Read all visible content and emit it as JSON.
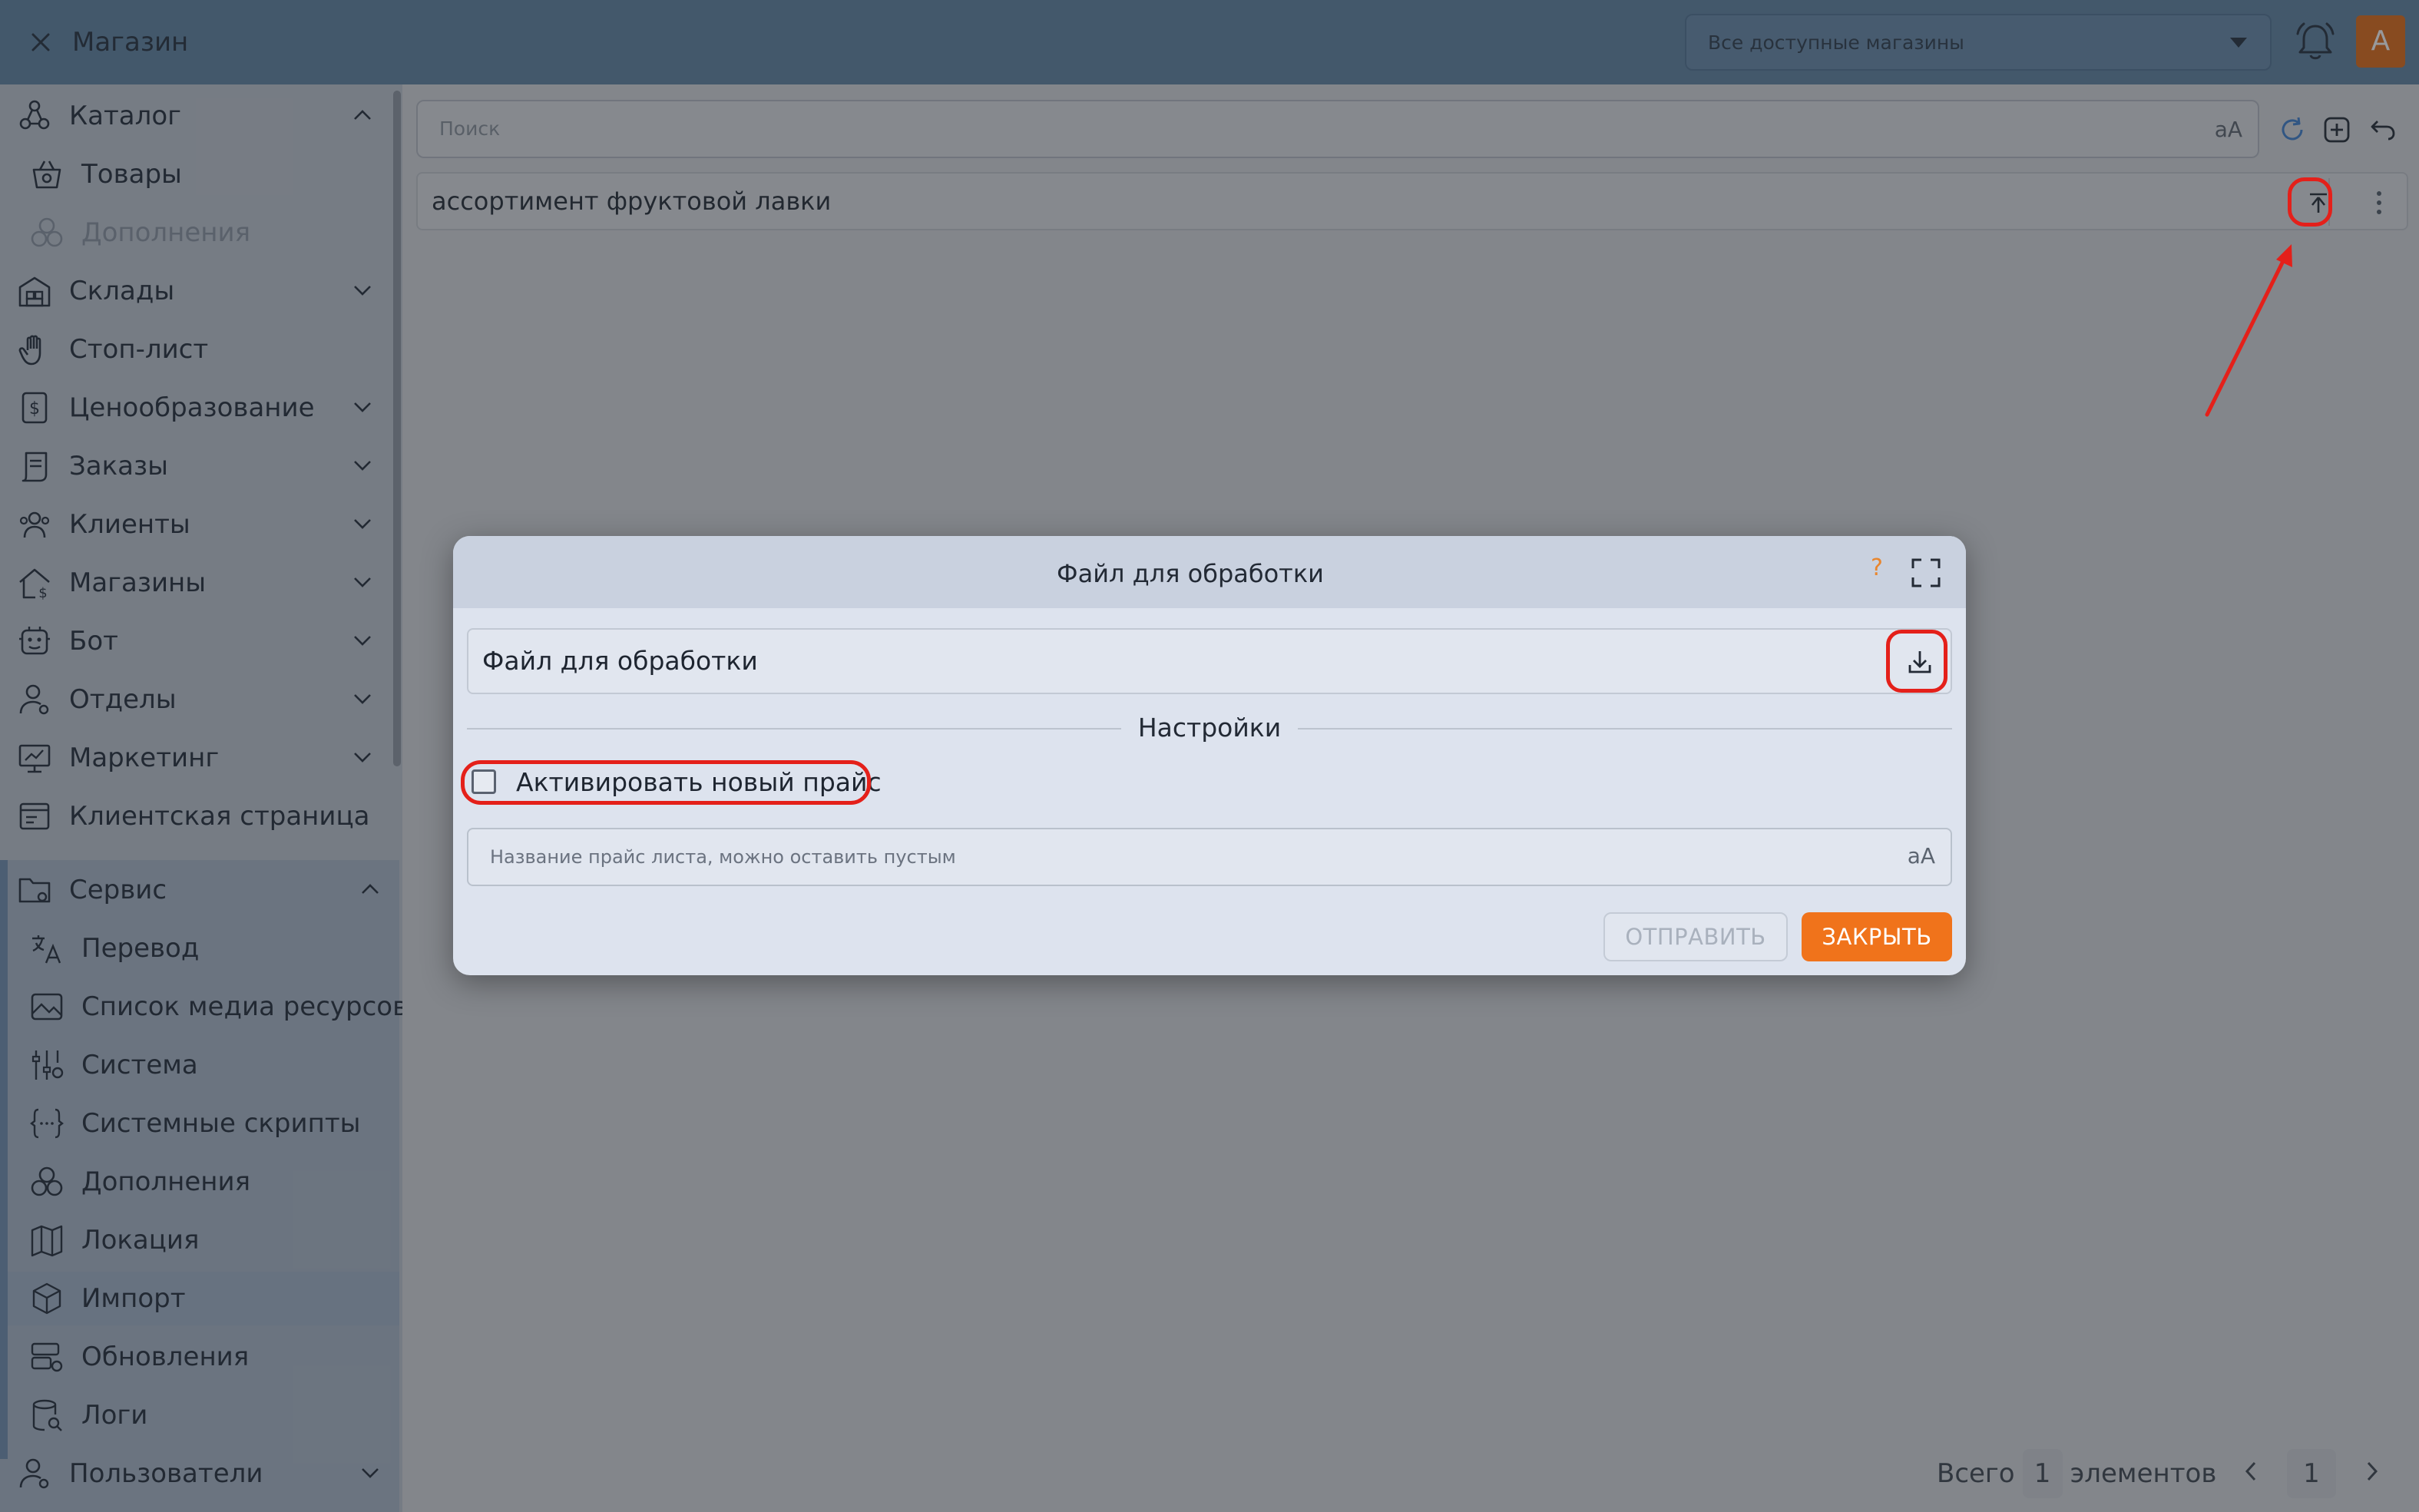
{
  "app": {
    "title": "Магазин"
  },
  "header": {
    "store_select_value": "Все доступные магазины",
    "avatar_letter": "A"
  },
  "sidebar": {
    "items": [
      {
        "label": "Каталог",
        "icon": "catalog-icon",
        "expanded": true
      },
      {
        "label": "Товары",
        "icon": "basket-icon"
      },
      {
        "label": "Дополнения",
        "icon": "addons-icon",
        "disabled": true
      },
      {
        "label": "Склады",
        "icon": "warehouse-icon"
      },
      {
        "label": "Стоп-лист",
        "icon": "hand-icon"
      },
      {
        "label": "Ценообразование",
        "icon": "price-icon"
      },
      {
        "label": "Заказы",
        "icon": "orders-icon"
      },
      {
        "label": "Клиенты",
        "icon": "clients-icon"
      },
      {
        "label": "Магазины",
        "icon": "stores-icon"
      },
      {
        "label": "Бот",
        "icon": "bot-icon"
      },
      {
        "label": "Отделы",
        "icon": "departments-icon"
      },
      {
        "label": "Маркетинг",
        "icon": "marketing-icon"
      },
      {
        "label": "Клиентская страница",
        "icon": "client-page-icon"
      },
      {
        "label": "Сервис",
        "icon": "folder-gear-icon",
        "expanded": true
      },
      {
        "label": "Перевод",
        "icon": "translate-icon"
      },
      {
        "label": "Список медиа ресурсов",
        "icon": "media-icon"
      },
      {
        "label": "Система",
        "icon": "system-icon"
      },
      {
        "label": "Системные скрипты",
        "icon": "scripts-icon"
      },
      {
        "label": "Дополнения",
        "icon": "addons-icon"
      },
      {
        "label": "Локация",
        "icon": "map-icon"
      },
      {
        "label": "Импорт",
        "icon": "import-icon",
        "active": true
      },
      {
        "label": "Обновления",
        "icon": "updates-icon"
      },
      {
        "label": "Логи",
        "icon": "logs-icon"
      },
      {
        "label": "Пользователи",
        "icon": "users-icon"
      }
    ]
  },
  "main": {
    "search_placeholder": "Поиск",
    "row": {
      "name": "ассортимент фруктовой лавки"
    },
    "pagination": {
      "total_label": "Всего",
      "total_count": "1",
      "items_label": "элементов",
      "current_page": "1"
    }
  },
  "dialog": {
    "title": "Файл для обработки",
    "help": "?",
    "file_field_label": "Файл для обработки",
    "settings_title": "Настройки",
    "checkbox_label": "Активировать новый прайс",
    "name_placeholder": "Название прайс листа, можно оставить пустым",
    "send_label": "ОТПРАВИТЬ",
    "close_label": "ЗАКРЫТЬ"
  },
  "colors": {
    "header": "#5d82a4",
    "accent": "#f0731b",
    "avatar": "#e06a14",
    "annotation": "#e4201a",
    "help": "#e9862d"
  }
}
